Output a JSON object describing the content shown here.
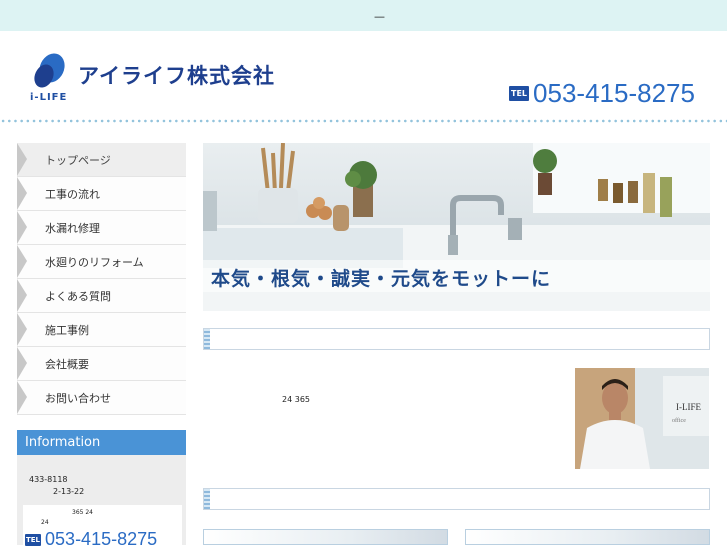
{
  "topbar": {
    "text": "—"
  },
  "header": {
    "company_name": "アイライフ株式会社",
    "logo_text": "i-LIFE",
    "tel_badge": "TEL",
    "tel_number": "053-415-8275"
  },
  "nav": {
    "items": [
      {
        "label": "トップページ"
      },
      {
        "label": "工事の流れ"
      },
      {
        "label": "水漏れ修理"
      },
      {
        "label": "水廻りのリフォーム"
      },
      {
        "label": "よくある質問"
      },
      {
        "label": "施工事例"
      },
      {
        "label": "会社概要"
      },
      {
        "label": "お問い合わせ"
      }
    ]
  },
  "information": {
    "heading": "Information",
    "postal": "433-8118",
    "address": "2-13-22",
    "hours1": "365 24",
    "hours2": "24",
    "tel_badge": "TEL",
    "tel_number": "053-415-8275"
  },
  "hero": {
    "caption": "本気・根気・誠実・元気をモットーに"
  },
  "intro": {
    "text": "24  365"
  },
  "photo": {
    "sign_text": "I-LIFE",
    "sign_sub": "office"
  },
  "colors": {
    "accent": "#2a6bc4",
    "brand_dark": "#1e3f8e",
    "info_head": "#4a93d6",
    "topbar": "#ddf3f3"
  }
}
